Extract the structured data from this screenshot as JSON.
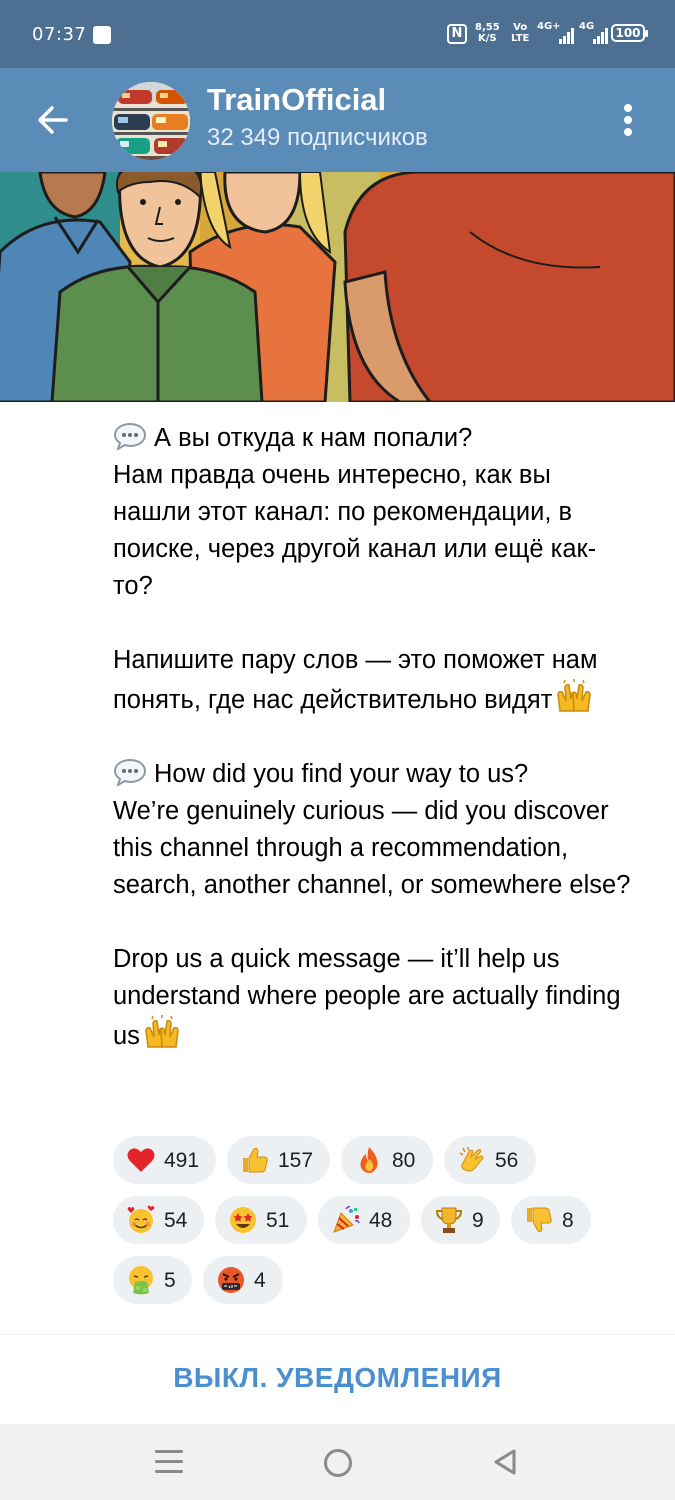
{
  "status_bar": {
    "time": "07:37",
    "nfc": "N",
    "speed": "8,55",
    "speed_unit": "K/S",
    "volte_top": "Vo",
    "volte_bottom": "LTE",
    "net1": "4G+",
    "net2": "4G",
    "battery": "100"
  },
  "header": {
    "title": "TrainOfficial",
    "subtitle": "32 349 подписчиков"
  },
  "post": {
    "paragraphs": [
      "А вы откуда к нам попали?\nНам правда очень интересно, как вы нашли этот канал: по рекомендации, в поиске, через другой канал или ещё как-то?",
      "Напишите пару слов — это поможет нам понять, где нас действительно видят",
      "How did you find your way to us?\nWe’re genuinely curious — did you discover this channel through a recommendation, search, another channel, or somewhere else?",
      "Drop us a quick message — it’ll help us understand where people are actually finding us"
    ]
  },
  "reactions": [
    {
      "icon": "red-heart-icon",
      "count": "491"
    },
    {
      "icon": "thumbs-up-icon",
      "count": "157"
    },
    {
      "icon": "fire-icon",
      "count": "80"
    },
    {
      "icon": "clapping-hands-icon",
      "count": "56"
    },
    {
      "icon": "smiling-face-with-hearts-icon",
      "count": "54"
    },
    {
      "icon": "star-struck-icon",
      "count": "51"
    },
    {
      "icon": "party-popper-icon",
      "count": "48"
    },
    {
      "icon": "trophy-icon",
      "count": "9"
    },
    {
      "icon": "thumbs-down-icon",
      "count": "8"
    },
    {
      "icon": "vomiting-face-icon",
      "count": "5"
    },
    {
      "icon": "cursing-face-icon",
      "count": "4"
    }
  ],
  "footer": {
    "mute_label": "ВЫКЛ. УВЕДОМЛЕНИЯ"
  },
  "colors": {
    "status_bar": "#4d7092",
    "header": "#5b8cb8",
    "accent": "#4a8fd0",
    "reaction_bg": "#edf0f3"
  }
}
